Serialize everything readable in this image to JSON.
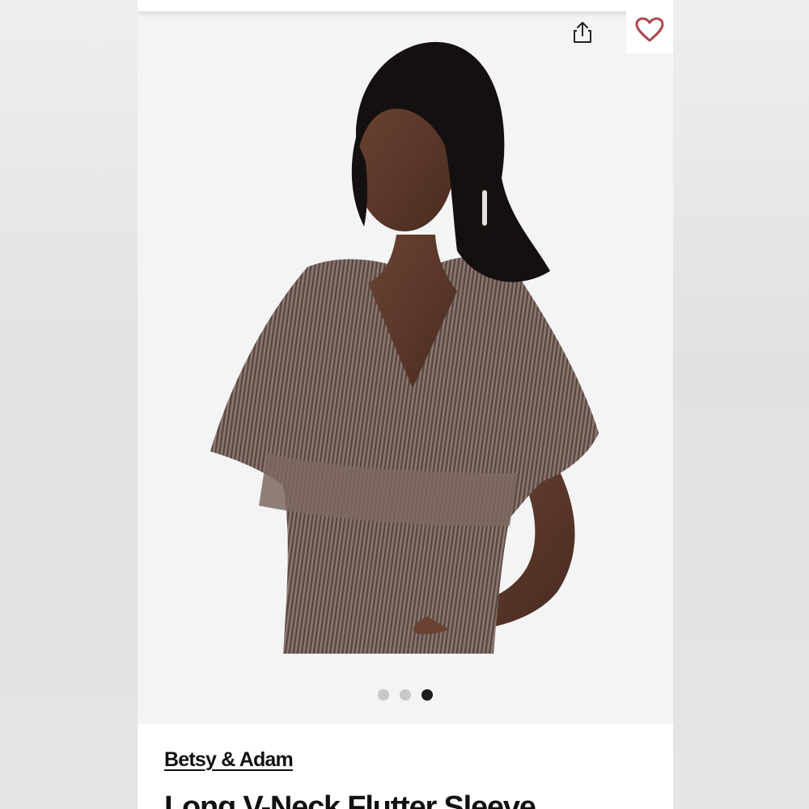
{
  "product": {
    "brand": "Betsy & Adam",
    "title": "Long V-Neck Flutter Sleeve",
    "image_alt": "Model wearing metallic pleated V-neck flutter sleeve dress"
  },
  "actions": {
    "share_icon": "share-icon",
    "favorite_icon": "heart-icon"
  },
  "carousel": {
    "total": 3,
    "current": 3
  },
  "colors": {
    "favorite_heart": "#b0464e",
    "dot_active": "#1c1c1c",
    "dot_inactive": "#c9c9c9",
    "page_bg": "#f4f4f4"
  }
}
